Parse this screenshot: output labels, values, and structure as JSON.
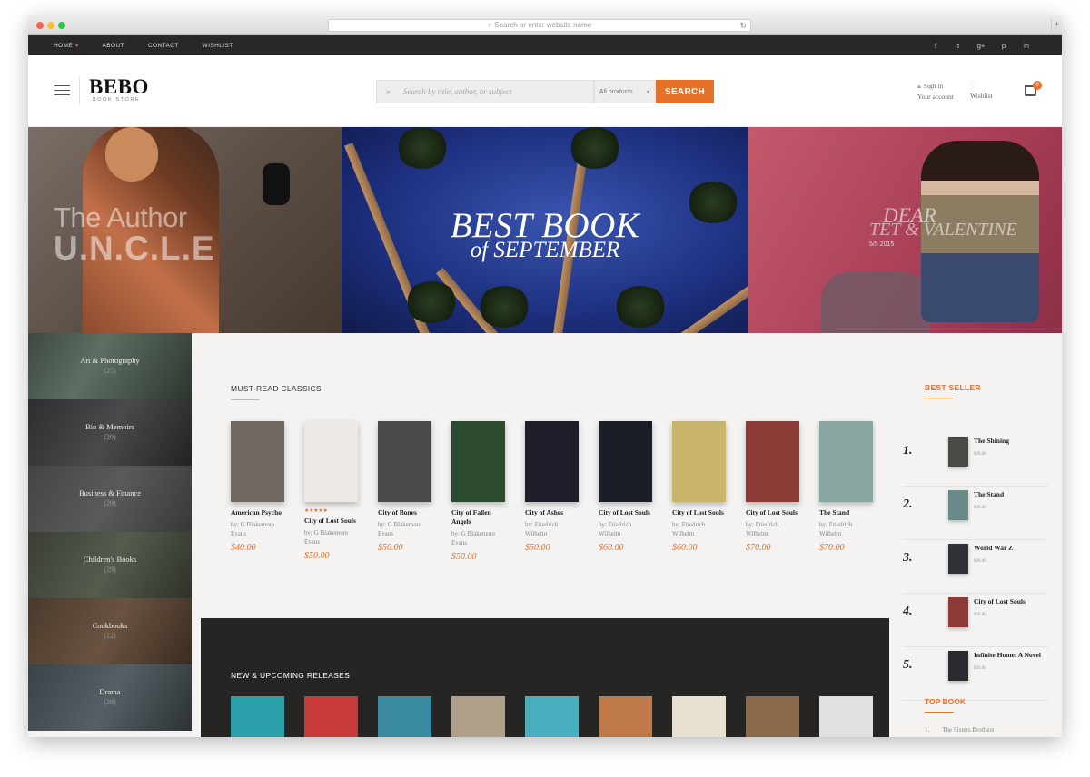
{
  "browser": {
    "url_placeholder": "Search or enter website name"
  },
  "topnav": {
    "items": [
      "HOME",
      "ABOUT",
      "CONTACT",
      "WISHLIST"
    ],
    "social": [
      "f",
      "t",
      "g+",
      "p",
      "in"
    ]
  },
  "header": {
    "logo_title": "BEBO",
    "logo_subtitle": "BOOK STORE",
    "search_placeholder": "Search by title, author, or subject",
    "category_select": "All products",
    "search_button": "SEARCH",
    "sign_in": "Sign in",
    "your_account": "Your account",
    "wishlist": "Wishlist",
    "cart_count": "0"
  },
  "banners": {
    "left_line1": "The Author",
    "left_line2": "U.N.C.L.E",
    "center_line1": "BEST BOOK",
    "center_line2": "of SEPTEMBER",
    "right_line1": "DEAR",
    "right_line2": "TET & VALENTINE",
    "right_date": "5/5 2015"
  },
  "categories": [
    {
      "name": "Art & Photography",
      "count": "(25)"
    },
    {
      "name": "Bio & Memoirs",
      "count": "(29)"
    },
    {
      "name": "Business & Finance",
      "count": "(29)"
    },
    {
      "name": "Children's Books",
      "count": "(29)"
    },
    {
      "name": "Cookbooks",
      "count": "(22)"
    },
    {
      "name": "Drama",
      "count": "(28)"
    }
  ],
  "must_read": {
    "title": "MUST-READ CLASSICS",
    "books": [
      {
        "title": "American Psycho",
        "author": "by: G Blakemore Evans",
        "price": "$40.00",
        "color": "#6e6860"
      },
      {
        "title": "City of Lost Souls",
        "author": "by: G Blakemore Evans",
        "price": "$50.00",
        "color": "#efe9e6",
        "stars": "★★★★★"
      },
      {
        "title": "City of Bones",
        "author": "by: G Blakemore Evans",
        "price": "$50.00",
        "color": "#4a4a48"
      },
      {
        "title": "City of Fallen Angels",
        "author": "by: G Blakemore Evans",
        "price": "$50.00",
        "color": "#2c4a2e"
      },
      {
        "title": "City of Ashes",
        "author": "by: Friedrich Wilhelm",
        "price": "$50.00",
        "color": "#1e1e2a"
      },
      {
        "title": "City of Lost Souls",
        "author": "by: Friedrich Wilhelm",
        "price": "$60.00",
        "color": "#1a1e26"
      },
      {
        "title": "City of Lost Souls",
        "author": "by: Friedrich Wilhelm",
        "price": "$60.00",
        "color": "#c8b46a"
      },
      {
        "title": "City of Lost Souls",
        "author": "by: Friedrich Wilhelm",
        "price": "$70.00",
        "color": "#8c3a36"
      },
      {
        "title": "The Stand",
        "author": "by: Friedrich Wilhelm",
        "price": "$70.00",
        "color": "#8aa6a2"
      }
    ]
  },
  "new_releases": {
    "title": "NEW & UPCOMING RELEASES",
    "colors": [
      "#2aa0aa",
      "#c83a3a",
      "#3a8aa0",
      "#b0a08a",
      "#4ab0c0",
      "#c07a4a",
      "#e8e0d0",
      "#8a6a4a",
      "#e0e0e0"
    ]
  },
  "best_seller": {
    "title": "BEST SELLER",
    "items": [
      {
        "rank": "1.",
        "title": "The Shining",
        "price": "$20.00",
        "color": "#4a4a44"
      },
      {
        "rank": "2.",
        "title": "The Stand",
        "price": "$20.00",
        "color": "#6a8a8a"
      },
      {
        "rank": "3.",
        "title": "World War Z",
        "price": "$20.00",
        "color": "#2e3236"
      },
      {
        "rank": "4.",
        "title": "City of Lost Souls",
        "price": "$20.00",
        "color": "#8c3a36"
      },
      {
        "rank": "5.",
        "title": "Infinite Home: A Novel",
        "price": "$20.00",
        "color": "#2a2a30"
      }
    ]
  },
  "top_book": {
    "title": "TOP BOOK",
    "first": {
      "rank": "1.",
      "title": "The Sisters Brothers"
    }
  },
  "colors": {
    "accent": "#e8712a",
    "dark": "#2a2826"
  }
}
